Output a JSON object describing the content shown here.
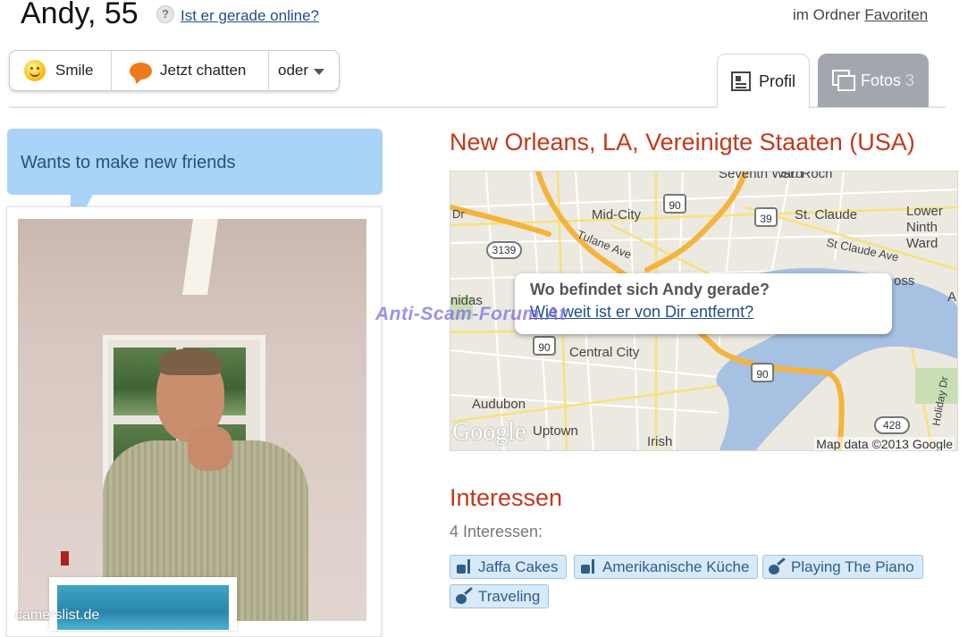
{
  "header": {
    "name_age": "Andy, 55",
    "help_symbol": "?",
    "online_link": "Ist er gerade online?",
    "folder_prefix": "im Ordner",
    "folder_link": "Favoriten"
  },
  "actions": {
    "smile_label": "Smile",
    "chat_label": "Jetzt chatten",
    "more_label": "oder"
  },
  "tabs": {
    "profil_label": "Profil",
    "fotos_label": "Fotos",
    "fotos_count": "3"
  },
  "status": {
    "text": "Wants to make new friends"
  },
  "photo": {
    "credit": "camerslist.de"
  },
  "location": {
    "title": "New Orleans, LA, Vereinigte Staaten (USA)"
  },
  "map": {
    "labels": {
      "seventh_ward": "Seventh Ward",
      "st_roch": "St. Roch",
      "mid_city": "Mid-City",
      "st_claude": "St. Claude",
      "lower_ninth_ward": "Lower Ninth Ward",
      "st_claude_ave": "St Claude Ave",
      "tulane_ave": "Tulane Ave",
      "central_city": "Central City",
      "audubon": "Audubon",
      "uptown": "Uptown",
      "irish": "Irish",
      "holiday_dr": "Holiday Dr",
      "dr": "Dr",
      "nidas": "nidas",
      "oss": "oss",
      "a": "A"
    },
    "shields": {
      "i90_a": "90",
      "r39": "39",
      "r3139": "3139",
      "i90_b": "90",
      "i90_c": "90",
      "r428": "428"
    },
    "google_logo": "Google",
    "attribution": "Map data ©2013 Google",
    "popup_question": "Wo befindet sich Andy gerade?",
    "popup_link": "Wie weit ist er von Dir entfernt?"
  },
  "watermark": "Anti-Scam-Forum.At",
  "interests": {
    "title": "Interessen",
    "count_label": "4 Interessen:",
    "tags": [
      {
        "label": "Jaffa Cakes",
        "icon": "food-icon"
      },
      {
        "label": "Amerikanische Küche",
        "icon": "food-icon"
      },
      {
        "label": "Playing The Piano",
        "icon": "guitar-icon"
      },
      {
        "label": "Traveling",
        "icon": "guitar-icon"
      }
    ]
  },
  "colors": {
    "accent_red": "#c3381c",
    "link_blue": "#1f4f86",
    "bubble_blue": "#a9d3f7",
    "tag_bg": "#d8e9f8",
    "tab_gray": "#a3a6ad"
  }
}
